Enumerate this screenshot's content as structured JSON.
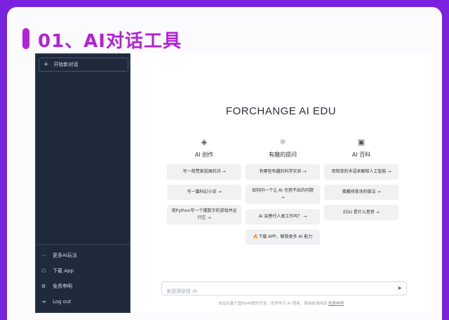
{
  "slide": {
    "title": "01、AI对话工具",
    "accent": "#b321d9",
    "background": "#7b22e0"
  },
  "sidebar": {
    "new_chat": "开始新对话",
    "items": [
      {
        "icon": "ellipsis-icon",
        "label": "更多AI玩法"
      },
      {
        "icon": "app-icon",
        "label": "下载 App"
      },
      {
        "icon": "gear-icon",
        "label": "免责申明"
      },
      {
        "icon": "logout-icon",
        "label": "Log out"
      }
    ]
  },
  "main": {
    "brand": "FORCHANGE AI EDU",
    "columns": [
      {
        "icon": "layers-icon",
        "title": "AI 创作",
        "prompts": [
          "写一首赞美祖国的诗 →",
          "写一篇科幻小说 →",
          "用Python写一个猜数字的游戏并运行它 →"
        ]
      },
      {
        "icon": "lightbulb-icon",
        "title": "有趣的提问",
        "prompts": [
          "有哪些有趣的科学实验 →",
          "如何问一个让 AI 也答不出的问题 →",
          "Ai 会替代人类工作吗？ →",
          "🔥下载 APP，解锁更多 AI 能力"
        ]
      },
      {
        "icon": "book-icon",
        "title": "AI 百科",
        "prompts": [
          "用简单的术语来解释人工智能 →",
          "蛋藏排骨汤的做法 →",
          "EDU 是什么意思 →"
        ]
      }
    ],
    "input_placeholder": "发送消息给 AI",
    "footer_text": "本站点基于国内API提供开发，仅供学习 AI 使用，使用前请阅读",
    "footer_link": "免责申明"
  }
}
